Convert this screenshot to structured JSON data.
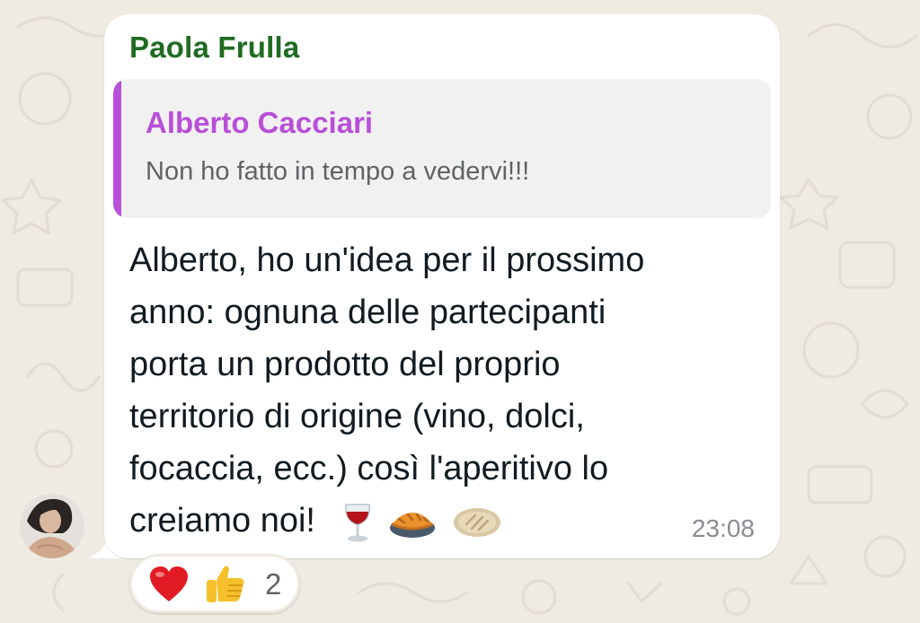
{
  "chat": {
    "message": {
      "sender": "Paola Frulla",
      "quoted": {
        "author": "Alberto Cacciari",
        "text": "Non ho fatto in tempo a vedervi!!!"
      },
      "lines": [
        "Alberto, ho un'idea per il prossimo",
        "anno: ognuna delle partecipanti",
        "porta un prodotto del proprio",
        "territorio di origine (vino, dolci,",
        "focaccia, ecc.) così l'aperitivo lo",
        "creiamo noi!"
      ],
      "inline_emojis": [
        "wine-glass-icon",
        "pie-icon",
        "flatbread-icon"
      ],
      "time": "23:08"
    },
    "reactions": {
      "emojis": [
        "heart-icon",
        "thumbs-up-icon"
      ],
      "count": "2"
    },
    "colors": {
      "background": "#efeae2",
      "bubble": "#ffffff",
      "sender_name": "#1f6b21",
      "quote_accent": "#b84fd8",
      "quote_background": "#f1f1f1"
    }
  }
}
